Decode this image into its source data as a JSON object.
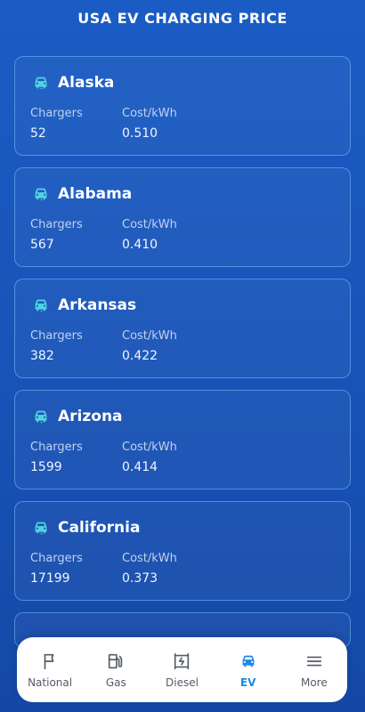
{
  "header": {
    "title": "USA EV CHARGING PRICE"
  },
  "labels": {
    "chargers": "Chargers",
    "cost": "Cost/kWh"
  },
  "colors": {
    "accent": "#1e88e5",
    "icon": "#4fd6e0"
  },
  "states": [
    {
      "name": "Alaska",
      "chargers": "52",
      "cost": "0.510"
    },
    {
      "name": "Alabama",
      "chargers": "567",
      "cost": "0.410"
    },
    {
      "name": "Arkansas",
      "chargers": "382",
      "cost": "0.422"
    },
    {
      "name": "Arizona",
      "chargers": "1599",
      "cost": "0.414"
    },
    {
      "name": "California",
      "chargers": "17199",
      "cost": "0.373"
    }
  ],
  "nav": [
    {
      "label": "National",
      "icon": "flag-icon"
    },
    {
      "label": "Gas",
      "icon": "gas-pump-icon"
    },
    {
      "label": "Diesel",
      "icon": "diesel-icon"
    },
    {
      "label": "EV",
      "icon": "ev-car-icon",
      "active": true
    },
    {
      "label": "More",
      "icon": "menu-icon"
    }
  ]
}
